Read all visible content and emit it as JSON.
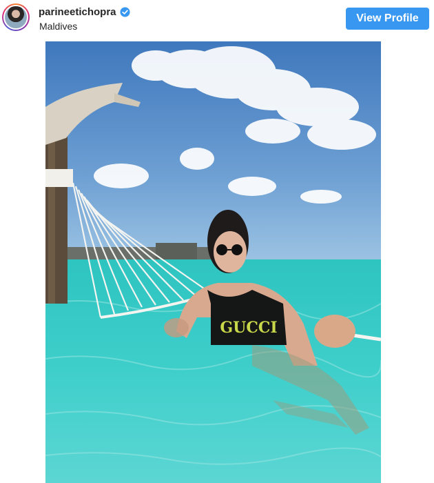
{
  "post": {
    "username": "parineetichopra",
    "location": "Maldives",
    "view_profile_label": "View Profile",
    "verified": true,
    "avatar_icon": "profile-avatar",
    "verified_icon": "verified-badge-icon"
  },
  "photo": {
    "swimsuit_text": "GUCCI",
    "colors": {
      "sky": "#5b8fc9",
      "water": "#32c2c2",
      "button": "#3897f0"
    }
  }
}
